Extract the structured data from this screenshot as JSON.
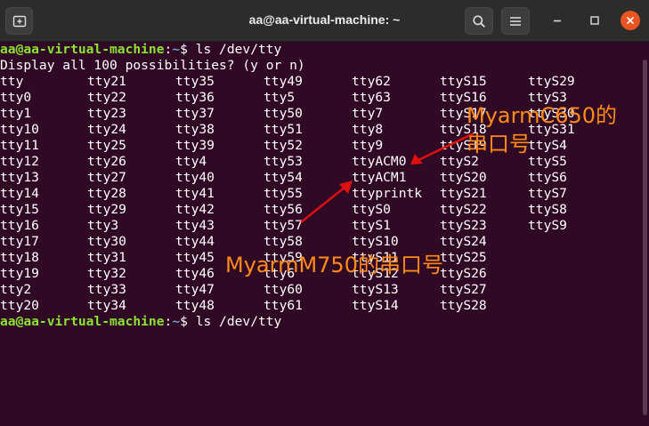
{
  "window": {
    "title": "aa@aa-virtual-machine: ~"
  },
  "icons": {
    "new_tab": "new-tab-icon",
    "search": "search-icon",
    "menu": "hamburger-menu-icon",
    "minimize": "minimize-icon",
    "maximize": "maximize-icon",
    "close": "close-icon"
  },
  "colors": {
    "terminal_bg": "#300a24",
    "prompt_user": "#8ae234",
    "prompt_path": "#729fcf",
    "annotation": "#ff8a1a",
    "arrow": "#e01010"
  },
  "terminal": {
    "prompt_user": "aa@aa-virtual-machine",
    "prompt_sep": ":",
    "prompt_path": "~",
    "prompt_symbol": "$ ",
    "command1": "ls /dev/tty",
    "possibilities_line": "Display all 100 possibilities? (y or n)",
    "command2": "ls /dev/tty",
    "columns": [
      [
        "tty",
        "tty0",
        "tty1",
        "tty10",
        "tty11",
        "tty12",
        "tty13",
        "tty14",
        "tty15",
        "tty16",
        "tty17",
        "tty18",
        "tty19",
        "tty2",
        "tty20"
      ],
      [
        "tty21",
        "tty22",
        "tty23",
        "tty24",
        "tty25",
        "tty26",
        "tty27",
        "tty28",
        "tty29",
        "tty3",
        "tty30",
        "tty31",
        "tty32",
        "tty33",
        "tty34"
      ],
      [
        "tty35",
        "tty36",
        "tty37",
        "tty38",
        "tty39",
        "tty4",
        "tty40",
        "tty41",
        "tty42",
        "tty43",
        "tty44",
        "tty45",
        "tty46",
        "tty47",
        "tty48"
      ],
      [
        "tty49",
        "tty5",
        "tty50",
        "tty51",
        "tty52",
        "tty53",
        "tty54",
        "tty55",
        "tty56",
        "tty57",
        "tty58",
        "tty59",
        "tty6",
        "tty60",
        "tty61"
      ],
      [
        "tty62",
        "tty63",
        "tty7",
        "tty8",
        "tty9",
        "ttyACM0",
        "ttyACM1",
        "ttyprintk",
        "ttyS0",
        "ttyS1",
        "ttyS10",
        "ttyS11",
        "ttyS12",
        "ttyS13",
        "ttyS14"
      ],
      [
        "ttyS15",
        "ttyS16",
        "ttyS17",
        "ttyS18",
        "ttyS19",
        "ttyS2",
        "ttyS20",
        "ttyS21",
        "ttyS22",
        "ttyS23",
        "ttyS24",
        "ttyS25",
        "ttyS26",
        "ttyS27",
        "ttyS28"
      ],
      [
        "ttyS29",
        "ttyS3",
        "ttyS30",
        "ttyS31",
        "ttyS4",
        "ttyS5",
        "ttyS6",
        "ttyS7",
        "ttyS8",
        "ttyS9"
      ]
    ]
  },
  "annotations": {
    "c650_line1": "MyarmC650的",
    "c650_line2": "串口号",
    "m750": "MyarmM750的串口号"
  }
}
